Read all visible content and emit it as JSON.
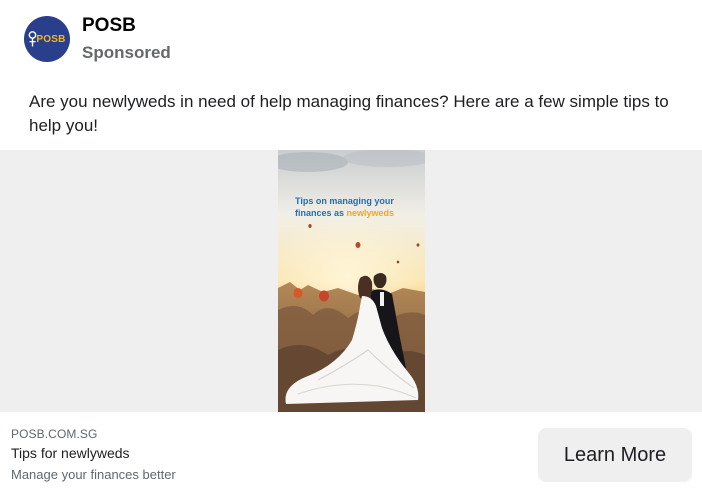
{
  "header": {
    "page_name": "POSB",
    "sponsored_label": "Sponsored",
    "avatar": {
      "logo_text": "POSB",
      "background_color": "#2a3f8c",
      "text_color": "#f6b51b"
    }
  },
  "post": {
    "text": "Are you newlyweds in need of help managing finances? Here are a few simple tips to help you!"
  },
  "media": {
    "image_headline_prefix": "Tips on managing your finances as ",
    "image_headline_highlight": "newlyweds",
    "headline_color": "#1f6fb8",
    "highlight_color": "#f5a623",
    "image_subject": "wedding couple embracing at sunset with hot air balloons"
  },
  "link_card": {
    "domain": "POSB.COM.SG",
    "headline": "Tips for newlyweds",
    "description": "Manage your finances better",
    "cta_label": "Learn More"
  }
}
